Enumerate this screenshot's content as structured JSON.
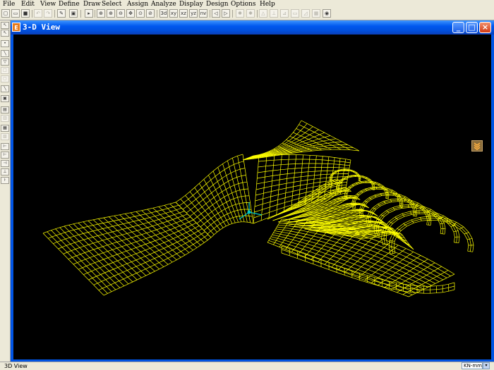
{
  "menu": {
    "items": [
      "File",
      "Edit",
      "View",
      "Define",
      "Draw",
      "Select",
      "Assign",
      "Analyze",
      "Display",
      "Design",
      "Options",
      "Help"
    ]
  },
  "toolbar": {
    "labels": {
      "d3": "3d",
      "xy": "xy",
      "xz": "xz",
      "yz": "yz",
      "nv": "nv"
    }
  },
  "window": {
    "title": "3-D View",
    "icon_text": "E",
    "minimize": "_",
    "maximize": "□",
    "close": "×"
  },
  "status": {
    "text": "3D View",
    "units": "KN-mm",
    "units_arrow": "▾"
  },
  "colors": {
    "mesh": "#ffff00",
    "axis": "#00c8c8",
    "background": "#000000"
  }
}
